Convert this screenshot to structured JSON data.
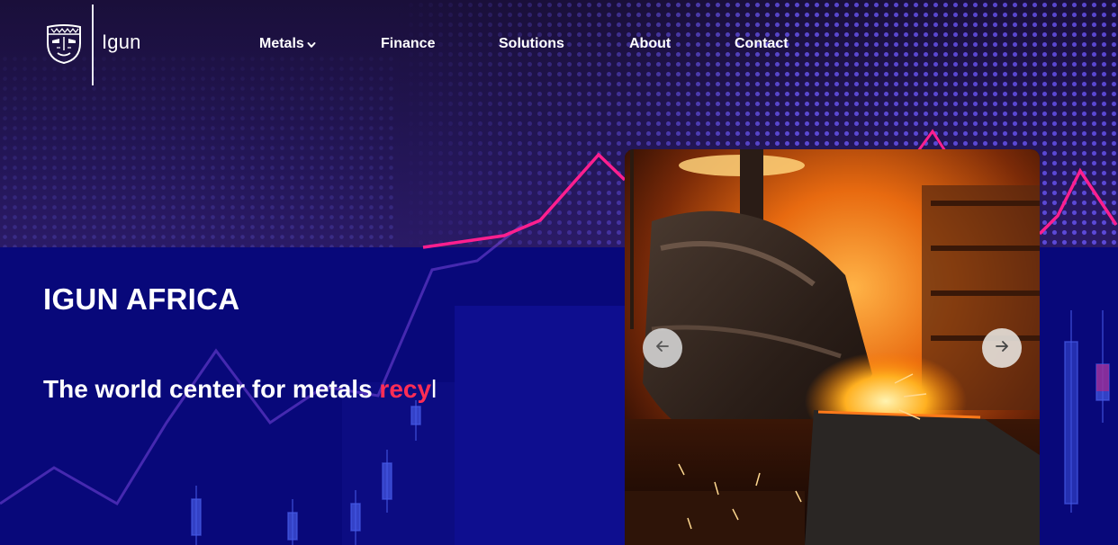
{
  "brand": {
    "name": "Igun",
    "logo_icon": "mask-logo-icon"
  },
  "nav": {
    "items": [
      {
        "label": "Metals",
        "has_dropdown": true,
        "icon": "chevron-down-icon"
      },
      {
        "label": "Finance"
      },
      {
        "label": "Solutions"
      },
      {
        "label": "About"
      },
      {
        "label": "Contact"
      }
    ]
  },
  "hero": {
    "title": "IGUN AFRICA",
    "tagline_prefix": "The world center for metals ",
    "tagline_accent": "recy",
    "tagline_cursor": "l"
  },
  "carousel": {
    "prev_icon": "arrow-left-icon",
    "next_icon": "arrow-right-icon",
    "image": "molten-metal-foundry-image"
  },
  "colors": {
    "accent": "#ff2d55",
    "top_band": "#221553",
    "bottom_band": "#08087a",
    "chart_line": "#ff1f8f"
  }
}
